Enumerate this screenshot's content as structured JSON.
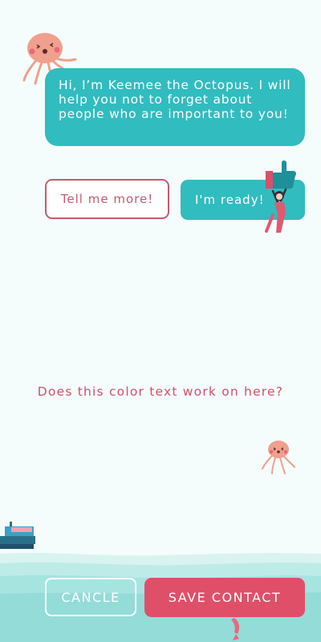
{
  "chat": {
    "message": "Hi, I’m Keemee the Octopus. I will help you not to forget about people who are important to you!"
  },
  "options": {
    "more_label": "Tell me more!",
    "ready_label": "I'm ready!"
  },
  "prompt_text": "Does this color text work on here?",
  "actions": {
    "cancel_label": "CANCLE",
    "save_label": "SAVE CONTACT"
  },
  "icons": {
    "mascot": "octopus-mascot-icon",
    "thumbs_up": "thumbs-up-icon",
    "character": "cheering-girl-icon",
    "small_octopus": "octopus-small-icon",
    "boat": "boat-icon",
    "fish": "fish-icon"
  },
  "colors": {
    "background": "#f4fcfc",
    "teal": "#31bcc0",
    "pink": "#e04f68",
    "outline_pink": "#c85a6e",
    "octopus": "#f0a08c",
    "water": "#9ee3e0"
  }
}
